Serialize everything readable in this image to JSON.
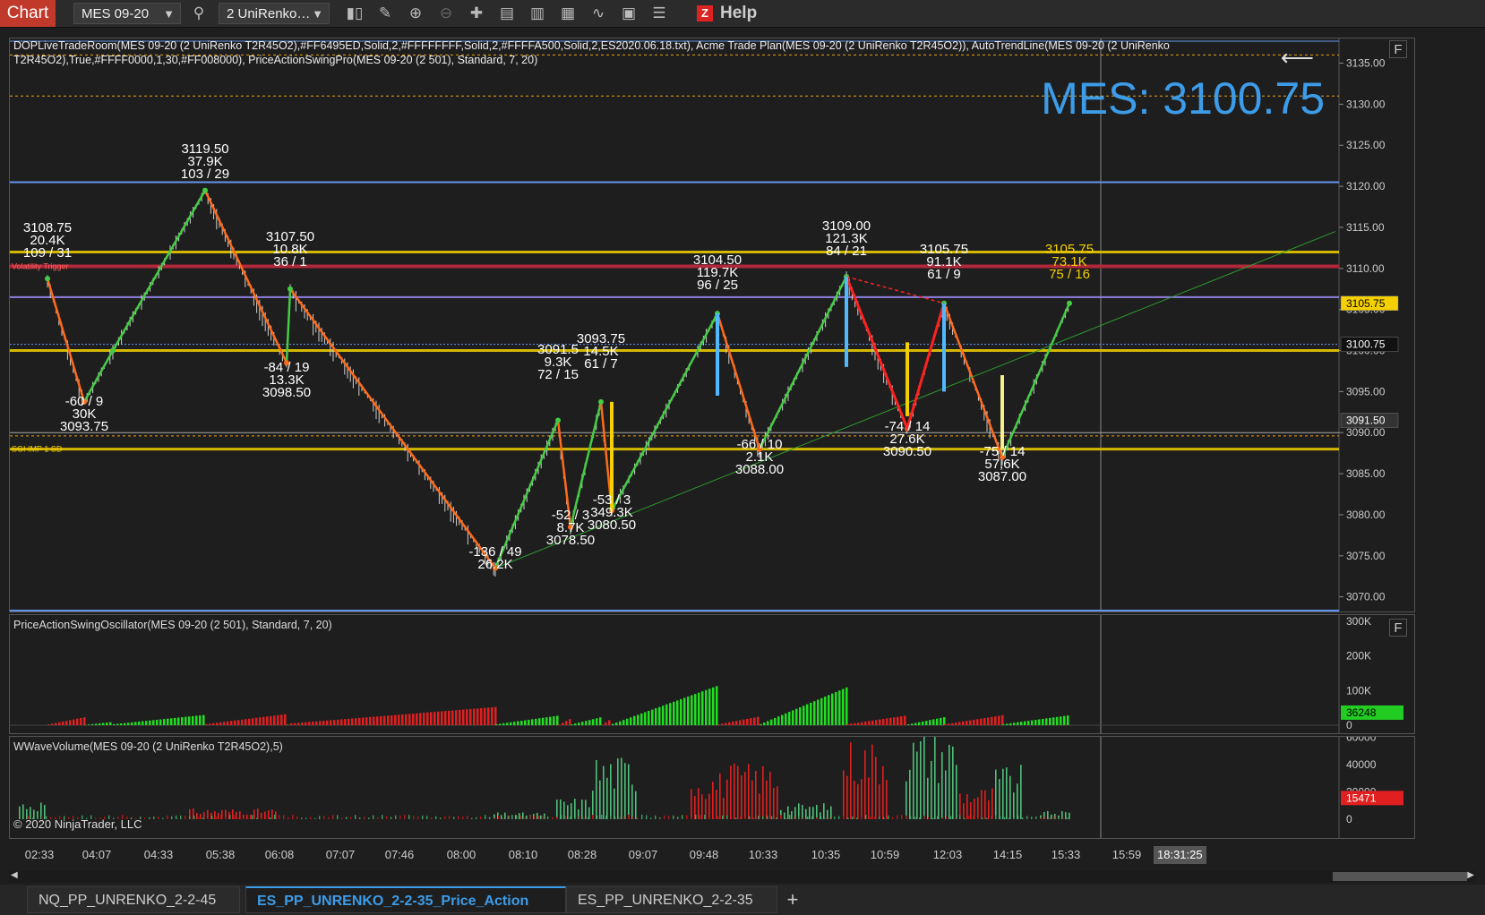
{
  "toolbar": {
    "chart_label": "Chart",
    "instrument": "MES 09-20",
    "bar_type": "2 UniRenko…",
    "help_label": "Help",
    "help_icon_text": "Z"
  },
  "price_pane": {
    "indicator_line_1": "DOPLiveTradeRoom(MES 09-20 (2 UniRenko T2R45O2),#FF6495ED,Solid,2,#FFFFFFFF,Solid,2,#FFFFA500,Solid,2,ES2020.06.18.txt), Acme Trade Plan(MES 09-20 (2 UniRenko T2R45O2)), AutoTrendLine(MES 09-20 (2 UniRenko",
    "indicator_line_2": "T2R45O2),True,#FFFF0000,1,30,#FF008000), PriceActionSwingPro(MES 09-20 (2 501), Standard, 7, 20)",
    "big_label": "MES: 3100.75",
    "f_button": "F",
    "y_ticks": [
      "3135.00",
      "3130.00",
      "3125.00",
      "3120.00",
      "3115.00",
      "3110.00",
      "3105.00",
      "3100.00",
      "3095.00",
      "3090.00",
      "3085.00",
      "3080.00",
      "3075.00",
      "3070.00"
    ],
    "price_tags": [
      {
        "value": "3105.75",
        "color": "#f5d000",
        "text_color": "#000000"
      },
      {
        "value": "3100.75",
        "color": "#111111",
        "text_color": "#ffffff"
      },
      {
        "value": "3091.50",
        "color": "#333333",
        "text_color": "#ffffff"
      }
    ],
    "level_labels": [
      "Volatility Trigger",
      "SGI IMP 1 SD"
    ],
    "swing_labels": [
      {
        "lines": [
          "3119.50",
          "37.9K",
          "103 / 29"
        ]
      },
      {
        "lines": [
          "3108.75",
          "20.4K",
          "109 / 31"
        ]
      },
      {
        "lines": [
          "3107.50",
          "10.8K",
          "36 / 1"
        ]
      },
      {
        "lines": [
          "-60 / 9",
          "30K",
          "3093.75"
        ]
      },
      {
        "lines": [
          "-84 / 19",
          "13.3K",
          "3098.50"
        ]
      },
      {
        "lines": [
          "3093.75",
          "14.5K",
          "61 / 7"
        ]
      },
      {
        "lines": [
          "3091.5",
          "9.3K",
          "72 / 15"
        ]
      },
      {
        "lines": [
          "-136 / 49",
          "26.2K"
        ]
      },
      {
        "lines": [
          "-52 / 3",
          "8.7K",
          "3078.50"
        ]
      },
      {
        "lines": [
          "-53 / 3",
          "349.3K",
          "3080.50"
        ]
      },
      {
        "lines": [
          "3104.50",
          "119.7K",
          "96 / 25"
        ]
      },
      {
        "lines": [
          "-66 / 10",
          "2.1K",
          "3088.00"
        ]
      },
      {
        "lines": [
          "3109.00",
          "121.3K",
          "84 / 21"
        ]
      },
      {
        "lines": [
          "3105.75",
          "91.1K",
          "61 / 9"
        ]
      },
      {
        "lines": [
          "-74 / 14",
          "27.6K",
          "3090.50"
        ]
      },
      {
        "lines": [
          "-75 / 14",
          "57.6K",
          "3087.00"
        ]
      },
      {
        "lines": [
          "3105.75",
          "73.1K",
          "75 / 16"
        ]
      }
    ]
  },
  "oscillator_pane": {
    "title": "PriceActionSwingOscillator(MES 09-20 (2 501), Standard, 7, 20)",
    "f_button": "F",
    "y_ticks": [
      "300K",
      "200K",
      "100K",
      "0"
    ],
    "current_tag": "36248",
    "current_tag_color": "#22cc22"
  },
  "volume_pane": {
    "title": "WWaveVolume(MES 09-20 (2 UniRenko T2R45O2),5)",
    "copyright": "© 2020 NinjaTrader, LLC",
    "y_ticks": [
      "60000",
      "40000",
      "20000",
      "0"
    ],
    "current_tag": "15471",
    "current_tag_color": "#e02020"
  },
  "time_axis": {
    "labels": [
      "02:33",
      "04:07",
      "04:33",
      "05:38",
      "06:08",
      "07:07",
      "07:46",
      "08:00",
      "08:10",
      "08:28",
      "09:07",
      "09:48",
      "10:33",
      "10:35",
      "10:59",
      "12:03",
      "14:15",
      "15:33",
      "15:59"
    ],
    "cursor_time": "18:31:25"
  },
  "tabs": [
    {
      "label": "NQ_PP_UNRENKO_2-2-45",
      "active": false
    },
    {
      "label": "ES_PP_UNRENKO_2-2-35_Price_Action",
      "active": true
    },
    {
      "label": "ES_PP_UNRENKO_2-2-35",
      "active": false
    }
  ],
  "colors": {
    "up_swing": "#44cc44",
    "down_swing": "#ff6a1a",
    "level_gold": "#d4b800",
    "level_red": "#b0283a",
    "level_purple": "#8f7fe0",
    "level_blue": "#6495ed",
    "accent": "#3d9ce8"
  },
  "chart_data": [
    {
      "type": "line",
      "title": "",
      "xlabel": "",
      "ylabel": "",
      "x": [
        "02:33",
        "04:07",
        "04:33",
        "05:38",
        "06:08",
        "06:12",
        "08:10",
        "08:28",
        "08:30",
        "09:05",
        "09:07",
        "10:33",
        "10:35",
        "10:59",
        "12:03",
        "14:15",
        "15:33",
        "15:59"
      ],
      "swing_points": [
        3108.75,
        3093.75,
        3100,
        3119.5,
        3098.5,
        3107.5,
        3073.5,
        3091.5,
        3078.5,
        3093.75,
        3080.5,
        3104.5,
        3088.0,
        3109.0,
        3090.5,
        3105.75,
        3087.0,
        3105.75
      ],
      "levels": [
        3131.0,
        3120.5,
        3112.0,
        3110.25,
        3106.5,
        3100.75,
        3100.0,
        3090.0,
        3088.0
      ],
      "last_price": 3100.75,
      "ylim": [
        3068,
        3138
      ],
      "grid": false
    },
    {
      "type": "bar",
      "title": "",
      "y_ticks": [
        "300K",
        "200K",
        "100K",
        "0"
      ],
      "ylim": [
        0,
        320000
      ],
      "last_value": 36248
    },
    {
      "type": "bar",
      "title": "",
      "y_ticks": [
        "60000",
        "40000",
        "20000",
        "0"
      ],
      "ylim": [
        0,
        70000
      ],
      "last_value": 15471
    }
  ]
}
